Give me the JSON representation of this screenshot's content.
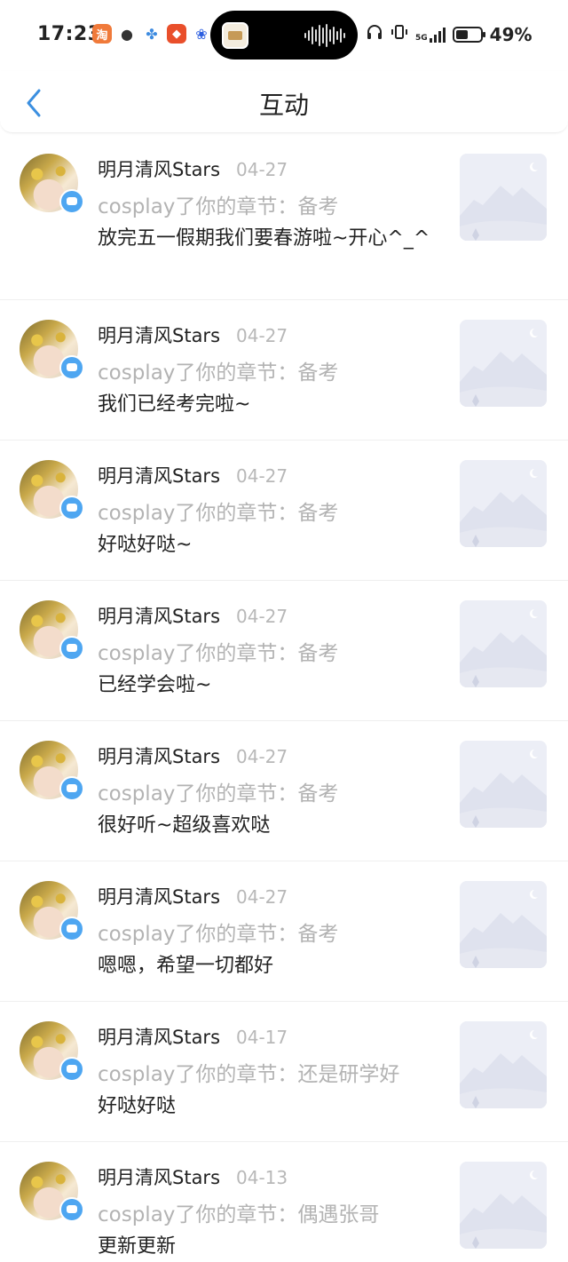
{
  "status_bar": {
    "time": "17:23",
    "network": "5G",
    "battery_percent": "49%",
    "icons": [
      "taobao-app-icon",
      "wechat-icon",
      "pinwheel-app-icon",
      "game-app-icon",
      "baidu-icon",
      "headphones-icon",
      "vibrate-icon",
      "signal-icon",
      "battery-icon"
    ]
  },
  "header": {
    "back_icon": "chevron-left-icon",
    "title": "互动"
  },
  "colors": {
    "accent": "#4ea6f1",
    "text_primary": "#222222",
    "text_secondary": "#b3b3b3",
    "divider": "#efefef"
  },
  "notifications": [
    {
      "username": "明月清风Stars",
      "date": "04-27",
      "action": "cosplay了你的章节：备考",
      "comment": "放完五一假期我们要春游啦~开心^_^"
    },
    {
      "username": "明月清风Stars",
      "date": "04-27",
      "action": "cosplay了你的章节：备考",
      "comment": "我们已经考完啦~"
    },
    {
      "username": "明月清风Stars",
      "date": "04-27",
      "action": "cosplay了你的章节：备考",
      "comment": "好哒好哒~"
    },
    {
      "username": "明月清风Stars",
      "date": "04-27",
      "action": "cosplay了你的章节：备考",
      "comment": "已经学会啦~"
    },
    {
      "username": "明月清风Stars",
      "date": "04-27",
      "action": "cosplay了你的章节：备考",
      "comment": "很好听~超级喜欢哒"
    },
    {
      "username": "明月清风Stars",
      "date": "04-27",
      "action": "cosplay了你的章节：备考",
      "comment": "嗯嗯，希望一切都好"
    },
    {
      "username": "明月清风Stars",
      "date": "04-17",
      "action": "cosplay了你的章节：还是研学好",
      "comment": "好哒好哒"
    },
    {
      "username": "明月清风Stars",
      "date": "04-13",
      "action": "cosplay了你的章节：偶遇张哥",
      "comment": "更新更新"
    }
  ]
}
